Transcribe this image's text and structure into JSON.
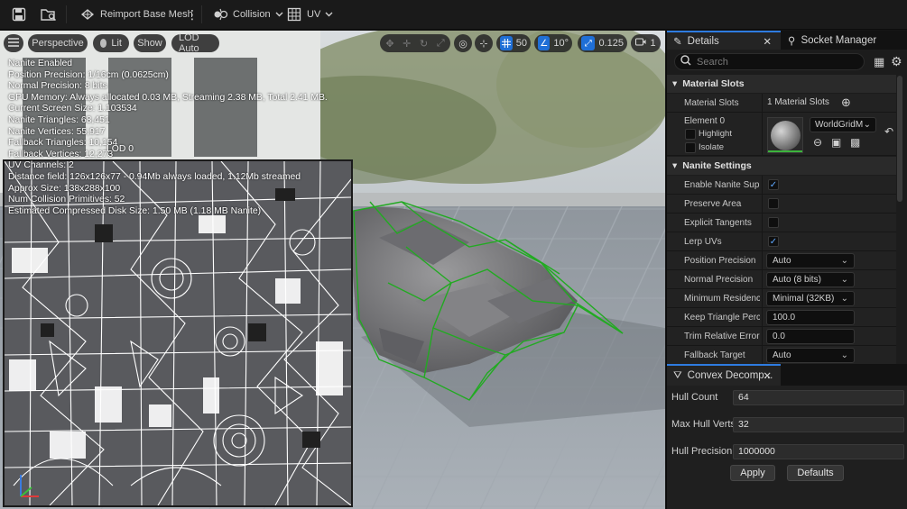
{
  "toolbar": {
    "save_icon": "save-icon",
    "browse_icon": "folder-browse-icon",
    "reimport_label": "Reimport Base Mesh",
    "collision_label": "Collision",
    "uv_label": "UV"
  },
  "viewport": {
    "menu_icon": "hamburger-icon",
    "perspective_label": "Perspective",
    "lit_label": "Lit",
    "show_label": "Show",
    "lod_label": "LOD Auto",
    "grid_value": "50",
    "angle_value": "10°",
    "scale_value": "0.125",
    "camera_speed": "1",
    "stats": [
      "Nanite Enabled",
      "Position Precision: 1/16cm (0.0625cm)",
      "Normal Precision: 8 bits",
      "GPU Memory: Always allocated 0.03 MB, Streaming 2.38 MB, Total 2.41 MB.",
      "Current Screen Size: 1.103534",
      "Nanite Triangles: 68,451",
      "Nanite Vertices: 55,917",
      "Fallback Triangles: 10,154",
      "Fallback Vertices: 12,273",
      "UV Channels: 2",
      "Distance field: 126x126x77 - 0.94Mb always loaded, 1.12Mb streamed",
      "Approx Size: 138x288x100",
      "Num Collision Primitives: 52",
      "Estimated Compressed Disk Size: 1.50 MB (1.18 MB Nanite)"
    ],
    "lod_overlay_text": "LOD 0",
    "colors": {
      "selection_wire": "#22aa22",
      "accent_blue": "#1f6fd6"
    }
  },
  "details": {
    "tab_details": "Details",
    "tab_socket": "Socket Manager",
    "search_placeholder": "Search",
    "material_slots_header": "Material Slots",
    "material_slots_label": "Material Slots",
    "material_slots_value": "1 Material Slots",
    "element_label": "Element 0",
    "highlight_label": "Highlight",
    "isolate_label": "Isolate",
    "material_name": "WorldGridM",
    "nanite_header": "Nanite Settings",
    "rows": [
      {
        "label": "Enable Nanite Suppo",
        "type": "check",
        "checked": true
      },
      {
        "label": "Preserve Area",
        "type": "check",
        "checked": false
      },
      {
        "label": "Explicit Tangents",
        "type": "check",
        "checked": false
      },
      {
        "label": "Lerp UVs",
        "type": "check",
        "checked": true
      },
      {
        "label": "Position Precision",
        "type": "dropdown",
        "value": "Auto"
      },
      {
        "label": "Normal Precision",
        "type": "dropdown",
        "value": "Auto (8 bits)"
      },
      {
        "label": "Minimum Residency",
        "type": "dropdown",
        "value": "Minimal (32KB)"
      },
      {
        "label": "Keep Triangle Percer",
        "type": "number",
        "value": "100.0"
      },
      {
        "label": "Trim Relative Error",
        "type": "number",
        "value": "0.0"
      },
      {
        "label": "Fallback Target",
        "type": "dropdown",
        "value": "Auto"
      }
    ]
  },
  "convex": {
    "tab_label": "Convex Decomp...",
    "hull_count_label": "Hull Count",
    "hull_count_value": "64",
    "max_hull_verts_label": "Max Hull Verts",
    "max_hull_verts_value": "32",
    "hull_precision_label": "Hull Precision",
    "hull_precision_value": "1000000",
    "apply_label": "Apply",
    "defaults_label": "Defaults"
  }
}
